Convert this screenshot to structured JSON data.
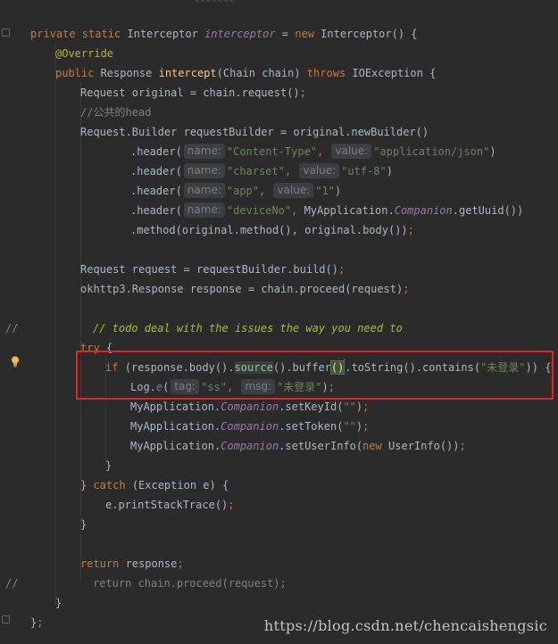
{
  "editor": {
    "top_fragment": "~~~~~~~",
    "watermark": "https://blog.csdn.net/chencaishengsic",
    "lines": [
      {
        "kw1": "private static ",
        "t1": "Interceptor ",
        "it1": "interceptor",
        "t2": " = ",
        "kw2": "new ",
        "t3": "Interceptor() {"
      },
      {
        "ann": "@Override"
      },
      {
        "kw1": "public ",
        "t1": "Response ",
        "fn": "intercept",
        "t2": "(Chain chain) ",
        "kw2": "throws ",
        "t3": "IOException {"
      },
      {
        "t1": "Request original = chain.request()",
        "semi": ";"
      },
      {
        "cm": "//公共的head"
      },
      {
        "t1": "Request.Builder requestBuilder = original.newBuilder()"
      },
      {
        "t1": ".header(",
        "h1": "name:",
        "s1": "\"Content-Type\"",
        "c1": ", ",
        "h2": "value:",
        "s2": "\"application/json\"",
        "t2": ")"
      },
      {
        "t1": ".header(",
        "h1": "name:",
        "s1": "\"charset\"",
        "c1": ", ",
        "h2": "value:",
        "s2": "\"utf-8\"",
        "t2": ")"
      },
      {
        "t1": ".header(",
        "h1": "name:",
        "s1": "\"app\"",
        "c1": ", ",
        "h2": "value:",
        "s2": "\"1\"",
        "t2": ")"
      },
      {
        "t1": ".header(",
        "h1": "name:",
        "s1": "\"deviceNo\"",
        "c1": ", ",
        "t2": "MyApplication.",
        "it1": "Companion",
        "t3": ".getUuid())"
      },
      {
        "t1": ".method(original.method(), original.body())",
        "semi": ";"
      },
      {
        "t1": "Request request = requestBuilder.build()",
        "semi": ";"
      },
      {
        "t1": "okhttp3.Response response = chain.proceed(request)",
        "semi": ";"
      },
      {
        "mark": "//",
        "todo": "// todo deal with the issues the way you need to"
      },
      {
        "kw1": "try ",
        "t1": "{"
      },
      {
        "kw1": "if ",
        "t1": "(response.body().",
        "src": "source",
        "t2": "().buffer",
        "p": "()",
        "t3": ".toString().contains(",
        "s1": "\"未登录\"",
        "t4": ")) {"
      },
      {
        "t1": "Log.",
        "it1": "e",
        "t2": "(",
        "h1": "tag:",
        "s1": "\"ss\"",
        "c1": ", ",
        "h2": "msg:",
        "s2": "\"未登录\"",
        "t3": ")",
        "semi": ";"
      },
      {
        "t1": "MyApplication.",
        "it1": "Companion",
        "t2": ".setKeyId(",
        "s1": "\"\"",
        "t3": ")",
        "semi": ";"
      },
      {
        "t1": "MyApplication.",
        "it1": "Companion",
        "t2": ".setToken(",
        "s1": "\"\"",
        "t3": ")",
        "semi": ";"
      },
      {
        "t1": "MyApplication.",
        "it1": "Companion",
        "t2": ".setUserInfo(",
        "kw1": "new ",
        "t3": "UserInfo())",
        "semi": ";"
      },
      {
        "t1": "}"
      },
      {
        "t1": "} ",
        "kw1": "catch ",
        "t2": "(Exception e) {"
      },
      {
        "t1": "e.printStackTrace()",
        "semi": ";"
      },
      {
        "t1": "}"
      },
      {
        "kw1": "return ",
        "t1": "response",
        "semi": ";"
      },
      {
        "mark": "//",
        "cm": "return chain.proceed(request);"
      },
      {
        "t1": "}"
      },
      {
        "t1": "}",
        "semi": ";"
      }
    ]
  }
}
